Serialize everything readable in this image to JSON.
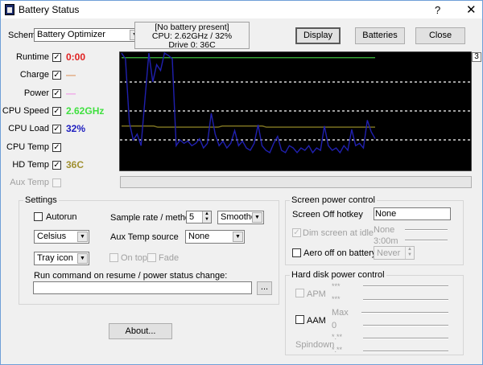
{
  "window": {
    "title": "Battery Status",
    "help": "?",
    "close": "✕"
  },
  "header": {
    "scheme_label": "Scheme",
    "scheme_value": "Battery Optimizer",
    "status_lines": [
      "[No battery present]",
      "CPU: 2.62GHz / 32%",
      "Drive 0: 36C"
    ],
    "display_label": "Display",
    "batteries_label": "Batteries",
    "close_label": "Close"
  },
  "metrics": [
    {
      "label": "Runtime",
      "checked": true,
      "value": "0:00",
      "color": "#e02020"
    },
    {
      "label": "Charge",
      "checked": true,
      "value": "—",
      "color": "#e0a070"
    },
    {
      "label": "Power",
      "checked": true,
      "value": "—",
      "color": "#f0a0e8"
    },
    {
      "label": "CPU Speed",
      "checked": true,
      "value": "2.62GHz",
      "color": "#40e040"
    },
    {
      "label": "CPU Load",
      "checked": true,
      "value": "32%",
      "color": "#2020c0"
    },
    {
      "label": "CPU Temp",
      "checked": true,
      "value": "",
      "color": "#000"
    },
    {
      "label": "HD Temp",
      "checked": true,
      "value": "36C",
      "color": "#a09030"
    },
    {
      "label": "Aux Temp",
      "checked": false,
      "value": "",
      "color": "#000"
    }
  ],
  "graph": {
    "scale_label": "3",
    "cpu_speed_pct": 96,
    "hd_temp_pct": [
      37,
      37,
      37,
      37,
      37,
      37,
      37,
      37,
      37,
      36,
      36,
      36,
      36,
      36,
      36,
      36,
      36,
      36,
      36,
      36,
      36,
      36,
      36,
      36,
      36,
      37,
      37,
      37,
      37,
      37,
      37,
      37,
      37,
      37,
      37,
      37,
      36,
      36,
      36,
      36,
      36,
      36,
      36,
      36,
      36,
      36,
      36,
      36,
      36,
      36,
      36,
      36,
      36,
      36,
      36,
      36,
      36,
      36,
      36,
      36,
      36,
      36,
      36,
      36
    ],
    "cpu_load_pct": [
      100,
      95,
      40,
      25,
      30,
      20,
      60,
      100,
      75,
      90,
      85,
      100,
      98,
      95,
      20,
      25,
      22,
      24,
      20,
      22,
      26,
      18,
      22,
      48,
      30,
      20,
      24,
      18,
      22,
      33,
      20,
      24,
      18,
      16,
      22,
      38,
      20,
      16,
      14,
      22,
      28,
      16,
      14,
      20,
      18,
      14,
      18,
      16,
      20,
      14,
      18,
      16,
      37,
      20,
      16,
      18,
      14,
      20,
      16,
      34,
      20,
      22,
      18,
      42,
      32,
      26
    ],
    "colors": {
      "background": "#000000",
      "speed": "#40c040",
      "load": "#2020b0",
      "temp": "#7a7020",
      "grid": "#ffffff"
    }
  },
  "settings": {
    "title": "Settings",
    "autorun": "Autorun",
    "sample_label": "Sample rate / method",
    "sample_value": "5",
    "method_value": "Smoothed",
    "units_value": "Celsius",
    "aux_source_label": "Aux Temp source",
    "aux_source_value": "None",
    "tray_value": "Tray icon",
    "on_top": "On top",
    "fade": "Fade",
    "run_cmd_label": "Run command on resume / power status change:",
    "run_cmd_value": "",
    "browse": "..."
  },
  "about_label": "About...",
  "screen": {
    "title": "Screen power control",
    "hotkey_label": "Screen Off hotkey",
    "hotkey_value": "None",
    "dim_label": "Dim screen at idle",
    "dim_top": "None",
    "dim_bottom": "3:00m",
    "aero_label": "Aero off on battery",
    "aero_value": "Never"
  },
  "disk": {
    "title": "Hard disk power control",
    "apm": "APM",
    "apm_top": "***",
    "apm_bottom": "***",
    "aam": "AAM",
    "aam_top": "Max",
    "aam_bottom": "0",
    "spindown": "Spindown",
    "spin_top": "*.**",
    "spin_bottom": "*.**"
  }
}
